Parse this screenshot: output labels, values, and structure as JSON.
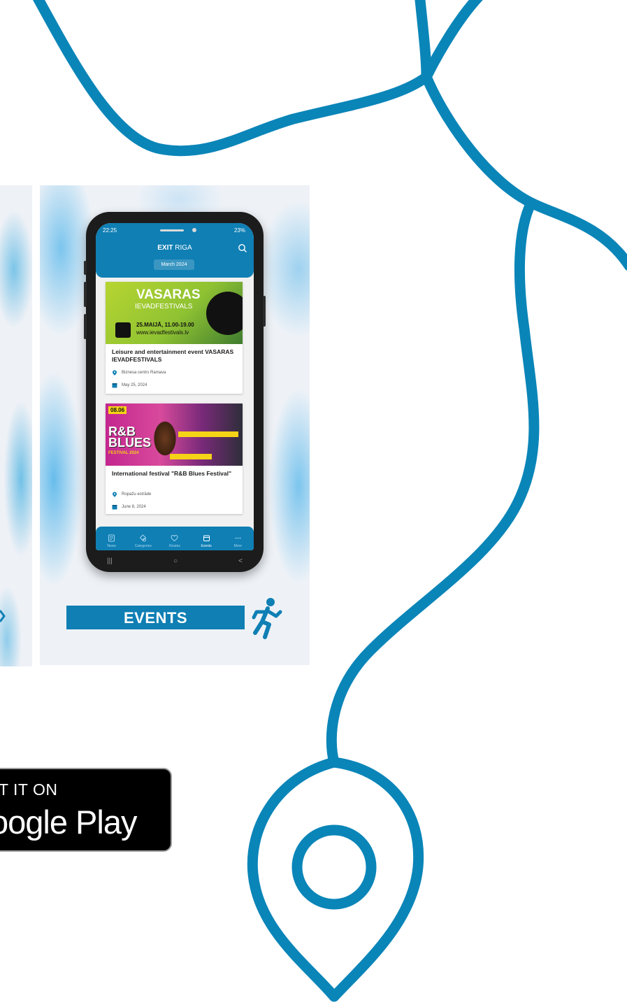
{
  "phone": {
    "status": {
      "time": "22:25",
      "battery": "23%"
    },
    "header": {
      "title_bold": "EXIT",
      "title_light": "RIGA",
      "month": "March 2024"
    },
    "events": [
      {
        "title": "Leisure and entertainment event VASARAS IEVADFESTIVALS",
        "location": "Biznesa centrs Ramava",
        "date": "May 25, 2024",
        "poster": {
          "headline": "VASARAS",
          "subline": "IEVADFESTIVALS",
          "when": "25.MAIJĀ, 11.00-19.00",
          "url": "www.ievadfestivals.lv"
        }
      },
      {
        "title": "International festival \"R&B Blues Festival\"",
        "location": "Ropažu estrāde",
        "date": "June 8, 2024",
        "poster": {
          "date_badge": "08.06",
          "headline": "R&B BLUES",
          "subline": "FESTIVAL 2024"
        }
      }
    ],
    "nav": [
      {
        "label": "News",
        "icon": "news-icon"
      },
      {
        "label": "Categories",
        "icon": "categories-icon"
      },
      {
        "label": "Routes",
        "icon": "heart-icon"
      },
      {
        "label": "Events",
        "icon": "calendar-icon",
        "active": true
      },
      {
        "label": "More",
        "icon": "more-icon"
      }
    ],
    "system_nav": [
      "|||",
      "○",
      "<"
    ]
  },
  "banner": {
    "label": "EVENTS"
  },
  "store_badge": {
    "small": "T IT ON",
    "big": "oogle Play"
  },
  "colors": {
    "brand": "#0f7fb4",
    "route_line": "#0a85b8",
    "badge_bg": "#000000"
  }
}
